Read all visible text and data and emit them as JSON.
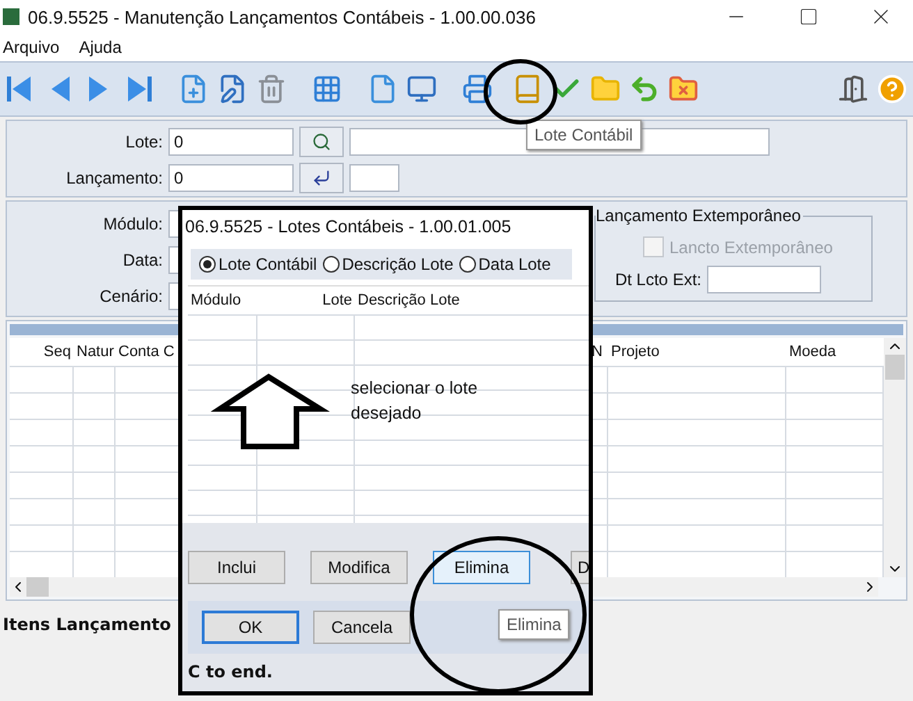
{
  "window": {
    "title": "06.9.5525 - Manutenção Lançamentos Contábeis - 1.00.00.036"
  },
  "menu": [
    "Arquivo",
    "Ajuda"
  ],
  "toolbar": {
    "tooltip": "Lote Contábil"
  },
  "header_form": {
    "lote": {
      "label": "Lote:",
      "value": "0"
    },
    "lancamento": {
      "label": "Lançamento:",
      "value": "0"
    }
  },
  "details_form": {
    "labels": [
      "Módulo:",
      "Data:",
      "Cenário:"
    ],
    "extemporaneo": {
      "title": "Lançamento Extemporâneo",
      "checkbox": {
        "label": "Lancto Extemporâneo",
        "checked": false,
        "disabled": true
      },
      "date_label": "Dt Lcto Ext:"
    }
  },
  "grid": {
    "columns": [
      "Seq",
      "Natur",
      "Conta C",
      "N",
      "Projeto",
      "Moeda"
    ]
  },
  "section_label": "Itens Lançamento",
  "dialog": {
    "title": "06.9.5525 - Lotes Contábeis - 1.00.01.005",
    "radios": [
      {
        "label": "Lote Contábil",
        "selected": true
      },
      {
        "label": "Descrição Lote",
        "selected": false
      },
      {
        "label": "Data Lote",
        "selected": false
      }
    ],
    "columns": [
      "Módulo",
      "Lote",
      "Descrição Lote"
    ],
    "buttons": [
      {
        "label": "Inclui",
        "highlighted": false
      },
      {
        "label": "Modifica",
        "highlighted": false
      },
      {
        "label": "Elimina",
        "highlighted": true
      },
      {
        "label": "D",
        "highlighted": false
      }
    ],
    "footer_buttons": [
      {
        "label": "OK",
        "focused": true
      },
      {
        "label": "Cancela",
        "focused": false
      }
    ],
    "status": "C to end.",
    "tooltip": "Elimina"
  },
  "annotation": {
    "text": "selecionar o lote desejado"
  }
}
